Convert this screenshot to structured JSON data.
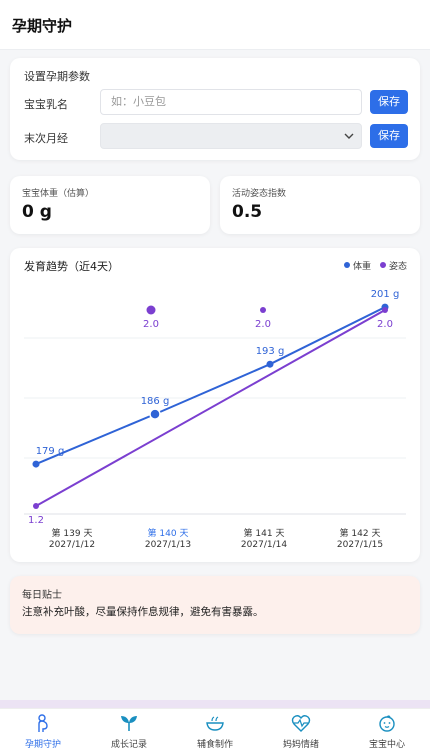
{
  "header": {
    "title": "孕期守护"
  },
  "settings": {
    "section_title": "设置孕期参数",
    "name_label": "宝宝乳名",
    "name_placeholder": "如：小豆包",
    "name_value": "",
    "period_label": "末次月经",
    "period_value": "",
    "save_label": "保存",
    "chevron_icon": "chevron-down-icon"
  },
  "metrics": [
    {
      "label": "宝宝体重（估算）",
      "value": "0 g"
    },
    {
      "label": "活动姿态指数",
      "value": "0.5"
    }
  ],
  "chart": {
    "title": "发育趋势（近4天）",
    "legend": [
      {
        "name": "体重",
        "color": "#2f63d6"
      },
      {
        "name": "姿态",
        "color": "#7b3fd0"
      }
    ],
    "days": [
      {
        "day": "第 139 天",
        "date": "2027/1/12"
      },
      {
        "day": "第 140 天",
        "date": "2027/1/13"
      },
      {
        "day": "第 141 天",
        "date": "2027/1/14"
      },
      {
        "day": "第 142 天",
        "date": "2027/1/15"
      }
    ],
    "active_index": 1
  },
  "chart_data": {
    "type": "line",
    "title": "发育趋势（近4天）",
    "categories": [
      "第 139 天",
      "第 140 天",
      "第 141 天",
      "第 142 天"
    ],
    "series": [
      {
        "name": "体重",
        "color": "#2f63d6",
        "values": [
          179,
          186,
          193,
          201
        ],
        "labels": [
          "179 g",
          "186 g",
          "193 g",
          "201 g"
        ]
      },
      {
        "name": "姿态",
        "color": "#7b3fd0",
        "values": [
          1.2,
          2.0,
          2.0,
          2.0
        ],
        "labels": [
          "1.2",
          "2.0",
          "2.0",
          "2.0"
        ]
      }
    ],
    "grid": true,
    "legend_position": "top-right"
  },
  "tip": {
    "title": "每日贴士",
    "text": "注意补充叶酸，尽量保持作息规律，避免有害暴露。"
  },
  "nav": {
    "active_index": 0,
    "items": [
      {
        "label": "孕期守护",
        "icon": "pregnancy-icon"
      },
      {
        "label": "成长记录",
        "icon": "growth-icon"
      },
      {
        "label": "辅食制作",
        "icon": "food-bowl-icon"
      },
      {
        "label": "妈妈情绪",
        "icon": "heart-pulse-icon"
      },
      {
        "label": "宝宝中心",
        "icon": "baby-face-icon"
      }
    ]
  }
}
